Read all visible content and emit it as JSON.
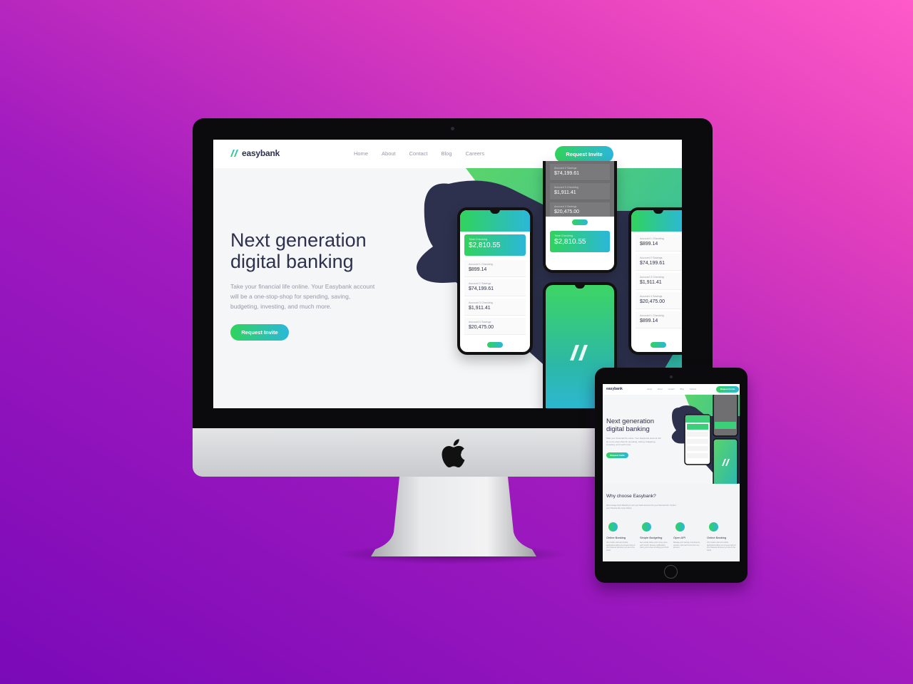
{
  "desktop": {
    "brand": "easybank",
    "nav": [
      "Home",
      "About",
      "Contact",
      "Blog",
      "Careers"
    ],
    "nav_button": "Request Invite",
    "hero_title_line1": "Next generation",
    "hero_title_line2": "digital banking",
    "hero_text": "Take your financial life online. Your Easybank account will be a one-stop-shop for spending, saving, budgeting, investing, and much more.",
    "hero_button": "Request Invite",
    "phones": {
      "left": {
        "balance_label": "Total Checking",
        "balance": "$2,810.55",
        "rows": [
          {
            "label": "Account 1 Checking",
            "amount": "$899.14"
          },
          {
            "label": "Account 2 Savings",
            "amount": "$74,199.61"
          },
          {
            "label": "Account 3 Checking",
            "amount": "$1,911.41"
          },
          {
            "label": "Account 4 Savings",
            "amount": "$20,475.00"
          }
        ]
      },
      "top_center": {
        "rows": [
          {
            "label": "Account 2 Savings",
            "amount": "$74,199.61"
          },
          {
            "label": "Account 3 Checking",
            "amount": "$1,911.41"
          },
          {
            "label": "Account 4 Savings",
            "amount": "$20,475.00"
          }
        ],
        "balance_label": "Total Checking",
        "balance": "$2,810.55"
      },
      "right": {
        "rows": [
          {
            "label": "Account 1 Checking",
            "amount": "$899.14"
          },
          {
            "label": "Account 2 Savings",
            "amount": "$74,199.61"
          },
          {
            "label": "Account 3 Checking",
            "amount": "$1,911.41"
          },
          {
            "label": "Account 4 Savings",
            "amount": "$20,475.00"
          },
          {
            "label": "Account 1 Checking",
            "amount": "$899.14"
          }
        ]
      }
    }
  },
  "tablet": {
    "brand": "easybank",
    "nav": [
      "Home",
      "About",
      "Contact",
      "Blog",
      "Careers"
    ],
    "nav_button": "Request Invite",
    "hero_title_line1": "Next generation",
    "hero_title_line2": "digital banking",
    "hero_text": "Take your financial life online. Your Easybank account will be a one-stop-shop for spending, saving, budgeting, investing, and much more.",
    "hero_button": "Request Invite",
    "why_title": "Why choose Easybank?",
    "why_text": "We leverage Open Banking to turn your bank account into your financial hub. Control your finances like never before.",
    "features": [
      {
        "title": "Online Banking",
        "text": "Our modern web and mobile applications allow you to keep track of your finances wherever you are in the world."
      },
      {
        "title": "Simple Budgeting",
        "text": "See exactly where your money goes each month. Receive notifications when you're close to hitting your limits."
      },
      {
        "title": "Open API",
        "text": "Manage your savings, investments, pension, and much more from one account."
      },
      {
        "title": "Online Banking",
        "text": "Our modern web and mobile applications allow you to keep track of your finances wherever you are in the world."
      }
    ]
  },
  "colors": {
    "brand_dark": "#2d314d",
    "gradient_start": "#31d35c",
    "gradient_end": "#2bb7da",
    "background_start": "#7a09b8",
    "background_end": "#ff5ac8"
  }
}
